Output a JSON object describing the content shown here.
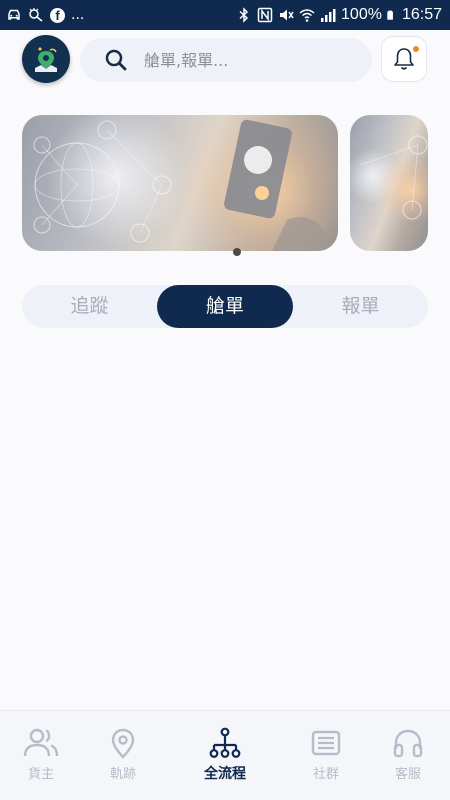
{
  "status_bar": {
    "overflow": "...",
    "battery": "100%",
    "time": "16:57",
    "icons": [
      "car-icon",
      "eye-icon",
      "facebook-icon",
      "bluetooth-icon",
      "nfc-icon",
      "mute-icon",
      "wifi-icon",
      "signal-icon",
      "battery-icon"
    ]
  },
  "header": {
    "logo_icon": "app-logo-icon",
    "search_placeholder": "艙單,報單...",
    "bell_icon": "bell-icon",
    "notification_dot_color": "#f08a24"
  },
  "banner": {
    "slides": 2,
    "active_index": 0
  },
  "tabs": [
    {
      "label": "追蹤",
      "active": false
    },
    {
      "label": "艙單",
      "active": true
    },
    {
      "label": "報單",
      "active": false
    }
  ],
  "bottom_nav": [
    {
      "label": "貨主",
      "icon": "users-icon",
      "active": false
    },
    {
      "label": "軌跡",
      "icon": "location-pin-icon",
      "active": false
    },
    {
      "label": "全流程",
      "icon": "flow-tree-icon",
      "active": true
    },
    {
      "label": "社群",
      "icon": "news-icon",
      "active": false
    },
    {
      "label": "客服",
      "icon": "headset-icon",
      "active": false
    }
  ],
  "colors": {
    "primary": "#0f2a4e",
    "inactive": "#b8bcc8",
    "accent": "#f08a24"
  }
}
